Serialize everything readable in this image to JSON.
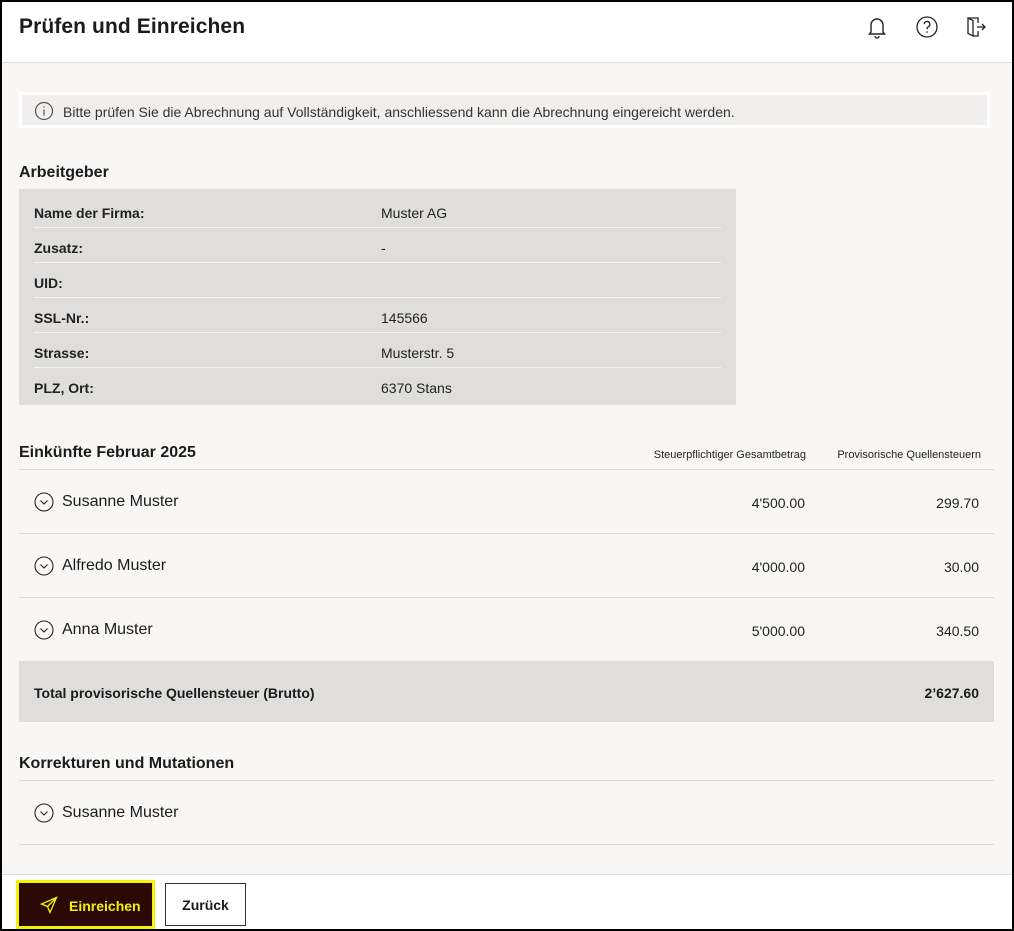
{
  "header": {
    "title": "Prüfen und Einreichen",
    "icons": [
      "bell-icon",
      "help-icon",
      "logout-icon"
    ]
  },
  "info": {
    "icon": "info-icon",
    "text": "Bitte prüfen Sie die Abrechnung auf Vollständigkeit, anschliessend kann die Abrechnung eingereicht werden."
  },
  "employer": {
    "title": "Arbeitgeber",
    "rows": [
      {
        "label": "Name der Firma:",
        "value": "Muster AG"
      },
      {
        "label": "Zusatz:",
        "value": "-"
      },
      {
        "label": "UID:",
        "value": ""
      },
      {
        "label": "SSL-Nr.:",
        "value": "145566"
      },
      {
        "label": "Strasse:",
        "value": "Musterstr. 5"
      },
      {
        "label": "PLZ, Ort:",
        "value": "6370 Stans"
      }
    ]
  },
  "income": {
    "title": "Einkünfte Februar 2025",
    "columns": [
      "Steuerpflichtiger Gesamtbetrag",
      "Provisorische Quellensteuern"
    ],
    "rows": [
      {
        "name": "Susanne Muster",
        "gross": "4'500.00",
        "tax": "299.70"
      },
      {
        "name": "Alfredo Muster",
        "gross": "4'000.00",
        "tax": "30.00"
      },
      {
        "name": "Anna Muster",
        "gross": "5'000.00",
        "tax": "340.50"
      }
    ],
    "total_label": "Total provisorische Quellensteuer (Brutto)",
    "total_value": "2’627.60"
  },
  "corrections": {
    "title": "Korrekturen und Mutationen",
    "rows": [
      {
        "name": "Susanne Muster"
      }
    ]
  },
  "footer": {
    "submit_label": "Einreichen",
    "back_label": "Zurück",
    "accent": "#f5f20a",
    "primary_bg": "#2b0a05"
  }
}
